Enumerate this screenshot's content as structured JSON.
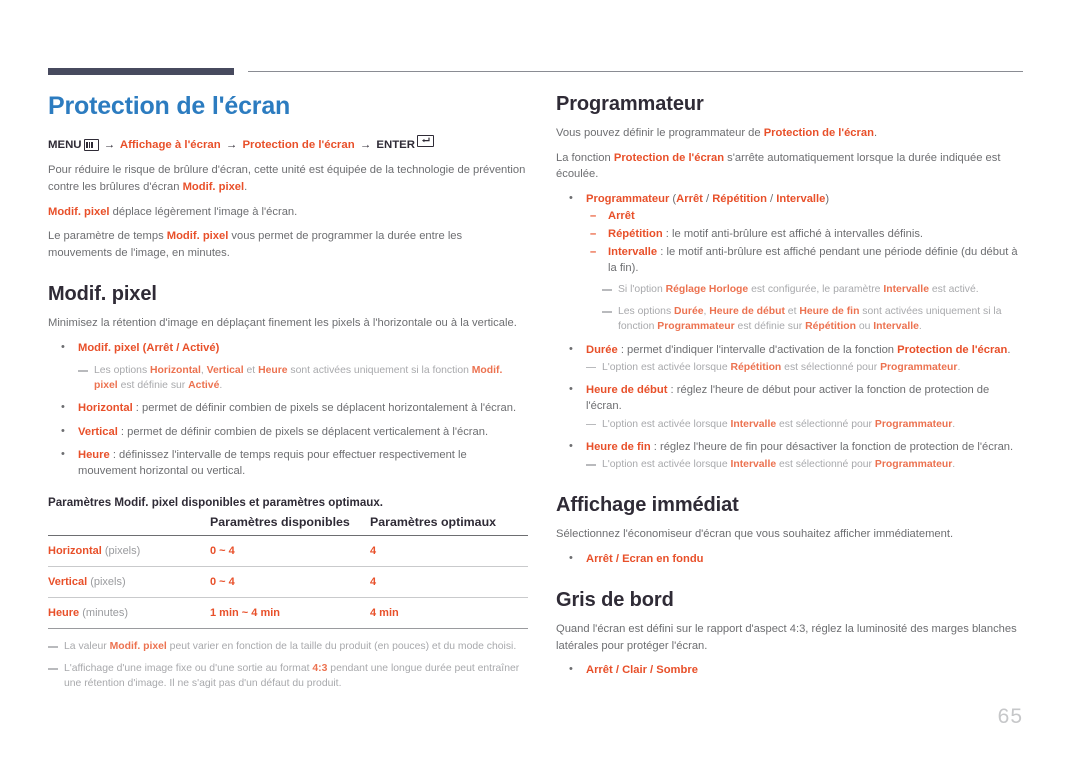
{
  "page": {
    "number": "65",
    "title": "Protection de l'écran",
    "title_color": "#2c7cc0",
    "accent_color": "#e8502a",
    "heading_color": "#2f2b36",
    "body_color": "#6d6e71",
    "rule_color": "#474a5e"
  },
  "left": {
    "menu_path": {
      "menu_label": "MENU",
      "arrow": "→",
      "item1": "Affichage à l'écran",
      "item2": "Protection de l'écran",
      "enter_label": "ENTER",
      "menu_icon": "menu-box-icon",
      "enter_icon": "enter-return-icon"
    },
    "intro1_a": "Pour réduire le risque de brûlure d'écran, cette unité est équipée de la technologie de prévention contre les brûlures d'écran ",
    "intro1_b": "Modif. pixel",
    "intro1_c": ".",
    "intro2_a": "Modif. pixel",
    "intro2_b": " déplace légèrement l'image à l'écran.",
    "intro3_a": "Le paramètre de temps ",
    "intro3_b": "Modif. pixel",
    "intro3_c": " vous permet de programmer la durée entre les mouvements de l'image, en minutes.",
    "section_modif_pixel": {
      "title": "Modif. pixel",
      "desc": "Minimisez la rétention d'image en déplaçant finement les pixels à l'horizontale ou à la verticale.",
      "bullet1_label": "Modif. pixel",
      "bullet1_options": "(Arrêt / Activé)",
      "note1_a": "Les options ",
      "note1_b": "Horizontal",
      "note1_c": ", ",
      "note1_d": "Vertical",
      "note1_e": " et ",
      "note1_f": "Heure",
      "note1_g": " sont activées uniquement si la fonction ",
      "note1_h": "Modif. pixel",
      "note1_i": " est définie sur ",
      "note1_j": "Activé",
      "note1_k": ".",
      "bullet2_label": "Horizontal",
      "bullet2_text": " : permet de définir combien de pixels se déplacent horizontalement à l'écran.",
      "bullet3_label": "Vertical",
      "bullet3_text": " : permet de définir combien de pixels se déplacent verticalement à l'écran.",
      "bullet4_label": "Heure",
      "bullet4_text": " : définissez l'intervalle de temps requis pour effectuer respectivement le mouvement horizontal ou vertical."
    },
    "table": {
      "caption": "Paramètres Modif. pixel disponibles et paramètres optimaux.",
      "headers": [
        "",
        "Paramètres disponibles",
        "Paramètres optimaux"
      ],
      "rows": [
        {
          "name": "Horizontal",
          "unit": "(pixels)",
          "available": "0 ~ 4",
          "optimal": "4"
        },
        {
          "name": "Vertical",
          "unit": "(pixels)",
          "available": "0 ~ 4",
          "optimal": "4"
        },
        {
          "name": "Heure",
          "unit": "(minutes)",
          "available": "1 min ~ 4 min",
          "optimal": "4 min"
        }
      ]
    },
    "footnotes": {
      "fn1_a": "La valeur ",
      "fn1_b": "Modif. pixel",
      "fn1_c": " peut varier en fonction de la taille du produit (en pouces) et du mode choisi.",
      "fn2_a": "L'affichage d'une image fixe ou d'une sortie au format ",
      "fn2_b": "4:3",
      "fn2_c": " pendant une longue durée peut entraîner une rétention d'image. Il ne s'agit pas d'un défaut du produit."
    }
  },
  "right": {
    "programmateur": {
      "title": "Programmateur",
      "p1_a": "Vous pouvez définir le programmateur de ",
      "p1_b": "Protection de l'écran",
      "p1_c": ".",
      "p2_a": "La fonction ",
      "p2_b": "Protection de l'écran",
      "p2_c": " s'arrête automatiquement lorsque la durée indiquée est écoulée.",
      "bullet1_label": "Programmateur",
      "bullet1_open": " (",
      "bullet1_opt1": "Arrêt",
      "bullet1_sep1": " / ",
      "bullet1_opt2": "Répétition",
      "bullet1_sep2": " / ",
      "bullet1_opt3": "Intervalle",
      "bullet1_close": ")",
      "sub1": "Arrêt",
      "sub2_label": "Répétition",
      "sub2_text": " : le motif anti-brûlure est affiché à intervalles définis.",
      "sub3_label": "Intervalle",
      "sub3_text": " : le motif anti-brûlure est affiché pendant une période définie (du début à la fin).",
      "note1_a": "Si l'option ",
      "note1_b": "Réglage Horloge",
      "note1_c": " est configurée, le paramètre ",
      "note1_d": "Intervalle",
      "note1_e": " est activé.",
      "note2_a": "Les options ",
      "note2_b": "Durée",
      "note2_c": ", ",
      "note2_d": "Heure de début",
      "note2_e": " et ",
      "note2_f": "Heure de fin",
      "note2_g": " sont activées uniquement si la fonction ",
      "note2_h": "Programmateur",
      "note2_i": " est définie sur ",
      "note2_j": "Répétition",
      "note2_k": " ou ",
      "note2_l": "Intervalle",
      "note2_m": ".",
      "bullet2_label": "Durée",
      "bullet2_text_a": " : permet d'indiquer l'intervalle d'activation de la fonction ",
      "bullet2_text_b": "Protection de l'écran",
      "bullet2_text_c": ".",
      "note3_a": "L'option est activée lorsque ",
      "note3_b": "Répétition",
      "note3_c": " est sélectionné pour ",
      "note3_d": "Programmateur",
      "note3_e": ".",
      "bullet3_label": "Heure de début",
      "bullet3_text": " : réglez l'heure de début pour activer la fonction de protection de l'écran.",
      "note4_a": "L'option est activée lorsque ",
      "note4_b": "Intervalle",
      "note4_c": " est sélectionné pour ",
      "note4_d": "Programmateur",
      "note4_e": ".",
      "bullet4_label": "Heure de fin",
      "bullet4_text": " : réglez l'heure de fin pour désactiver la fonction de protection de l'écran.",
      "note5_a": "L'option est activée lorsque ",
      "note5_b": "Intervalle",
      "note5_c": " est sélectionné pour ",
      "note5_d": "Programmateur",
      "note5_e": "."
    },
    "affichage": {
      "title": "Affichage immédiat",
      "desc": "Sélectionnez l'économiseur d'écran que vous souhaitez afficher immédiatement.",
      "bullet_opt1": "Arrêt",
      "bullet_sep": " / ",
      "bullet_opt2": "Ecran en fondu"
    },
    "gris": {
      "title": "Gris de bord",
      "desc": "Quand l'écran est défini sur le rapport d'aspect 4:3, réglez la luminosité des marges blanches latérales pour protéger l'écran.",
      "bullet_opt1": "Arrêt",
      "bullet_sep1": " / ",
      "bullet_opt2": "Clair",
      "bullet_sep2": " / ",
      "bullet_opt3": "Sombre"
    }
  }
}
